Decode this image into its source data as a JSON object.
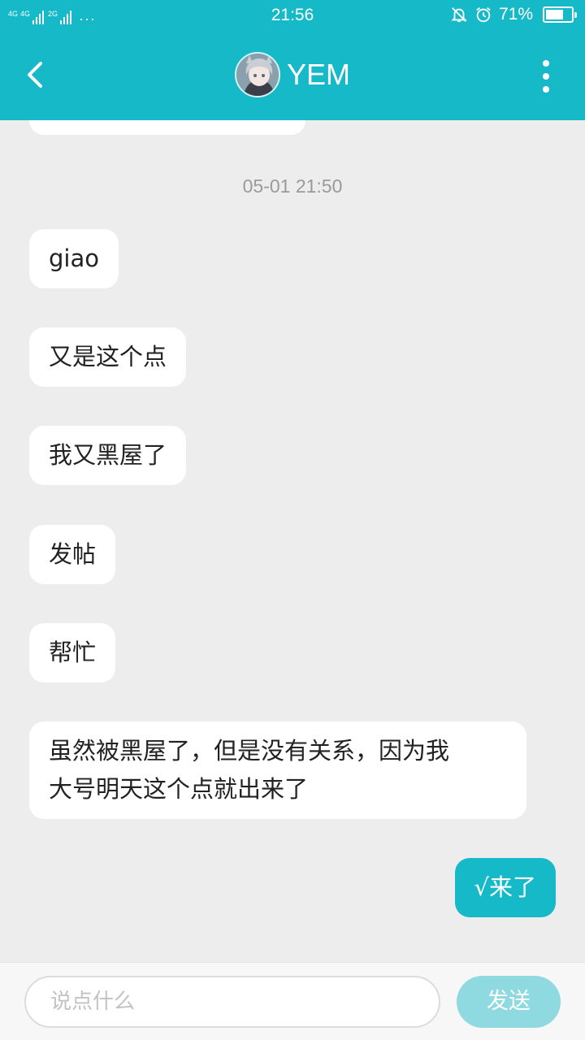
{
  "status_bar": {
    "network_1": "4G",
    "network_2": "4G",
    "network_3": "2G",
    "more": "···",
    "time": "21:56",
    "battery_percent": "71%",
    "battery_level": 0.71,
    "icons": [
      "signal-icon",
      "mute-bell-icon",
      "alarm-icon",
      "battery-icon"
    ]
  },
  "header": {
    "title": "YEM",
    "back_icon": "chevron-left-icon",
    "menu_icon": "more-vertical-icon"
  },
  "chat": {
    "timestamp": "05-01 21:50",
    "messages": [
      {
        "from": "other",
        "text": "giao"
      },
      {
        "from": "other",
        "text": "又是这个点"
      },
      {
        "from": "other",
        "text": "我又黑屋了"
      },
      {
        "from": "other",
        "text": "发帖"
      },
      {
        "from": "other",
        "text": "帮忙"
      },
      {
        "from": "other",
        "text": "虽然被黑屋了，但是没有关系，因为我\n大号明天这个点就出来了"
      },
      {
        "from": "me",
        "text": "√来了"
      }
    ]
  },
  "input": {
    "placeholder": "说点什么",
    "send_label": "发送"
  },
  "colors": {
    "accent": "#16b9c7",
    "send_disabled": "#8fd9e0",
    "chat_background": "#ededed"
  }
}
